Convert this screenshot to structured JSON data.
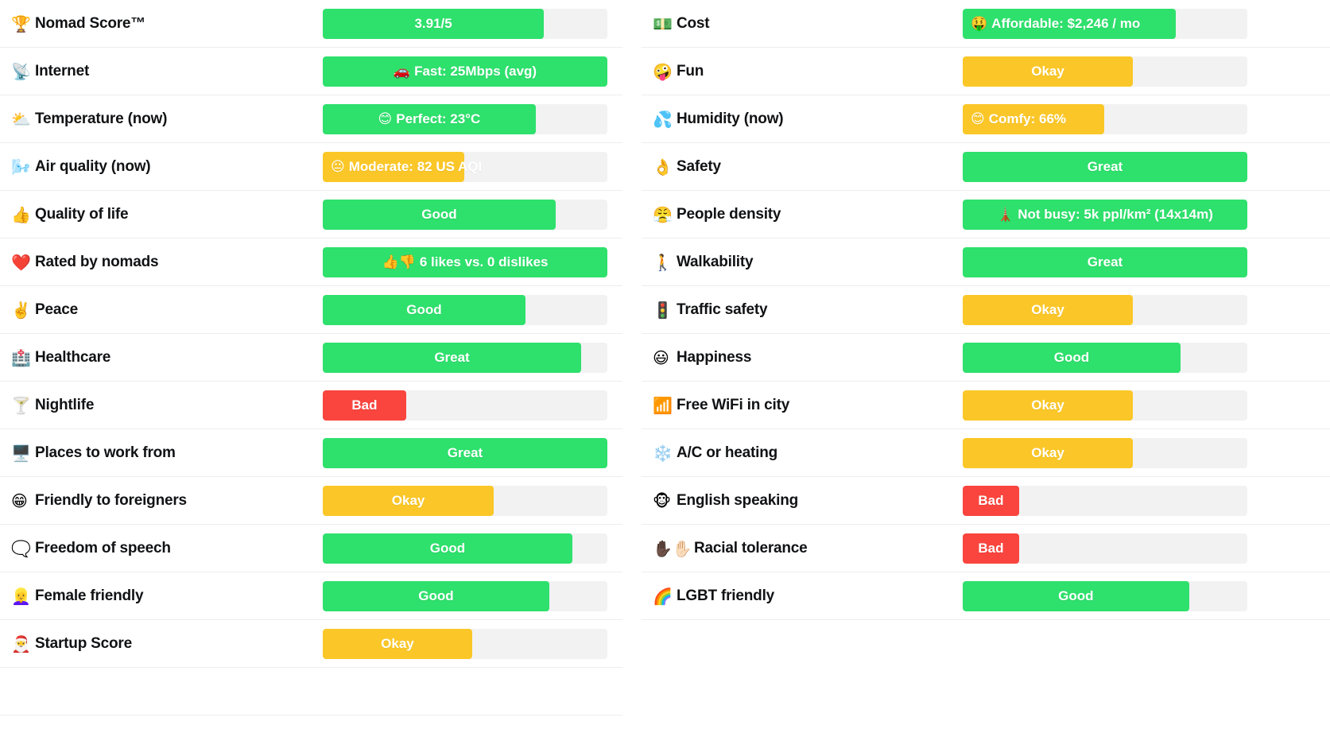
{
  "palette": {
    "good": "#2ee06c",
    "okay": "#fbc728",
    "bad": "#f9453e",
    "track": "#f2f2f3",
    "text_dark": "#111214",
    "text_light": "#ffffff",
    "row_border": "#ededee",
    "page_bg": "#ffffff"
  },
  "legend": {
    "good_label": "Good",
    "great_label": "Great",
    "okay_label": "Okay",
    "bad_label": "Bad"
  },
  "chart_data": {
    "type": "bar",
    "title": "",
    "xlabel": "",
    "ylabel": "",
    "orientation": "horizontal",
    "scale_note": "Bar fill fraction of full track width (0.0-1.0)",
    "columns": [
      "left",
      "right"
    ],
    "categories": [
      "Nomad Score™",
      "Internet",
      "Temperature (now)",
      "Air quality (now)",
      "Quality of life",
      "Rated by nomads",
      "Peace",
      "Healthcare",
      "Nightlife",
      "Places to work from",
      "Friendly to foreigners",
      "Freedom of speech",
      "Female friendly",
      "Startup Score",
      "Cost",
      "Fun",
      "Humidity (now)",
      "Safety",
      "People density",
      "Walkability",
      "Traffic safety",
      "Happiness",
      "Free WiFi in city",
      "A/C or heating",
      "English speaking",
      "Racial tolerance",
      "LGBT friendly"
    ],
    "values": [
      0.78,
      1.0,
      0.75,
      0.5,
      0.82,
      1.0,
      0.71,
      0.91,
      0.29,
      1.0,
      0.6,
      0.88,
      0.79,
      0.53,
      0.75,
      0.6,
      0.5,
      1.0,
      1.0,
      1.0,
      0.6,
      0.77,
      0.6,
      0.6,
      0.2,
      0.2,
      0.8
    ],
    "ratings": [
      "good",
      "good",
      "good",
      "okay",
      "good",
      "good",
      "good",
      "good",
      "bad",
      "good",
      "okay",
      "good",
      "good",
      "okay",
      "good",
      "okay",
      "okay",
      "good",
      "good",
      "good",
      "okay",
      "good",
      "okay",
      "okay",
      "bad",
      "bad",
      "good"
    ]
  },
  "left_column": {
    "rows": [
      {
        "icon": "🏆",
        "icon_name": "trophy-icon",
        "label": "Nomad Score™",
        "bar": {
          "rating": "good",
          "fill": 0.777,
          "text": "3.91/5",
          "text_mode": "centered",
          "emoji": ""
        }
      },
      {
        "icon": "📡",
        "icon_name": "satellite-antenna-icon",
        "label": "Internet",
        "bar": {
          "rating": "good",
          "fill": 1.0,
          "text": "Fast: 25Mbps (avg)",
          "text_mode": "centered",
          "emoji": "🚗"
        }
      },
      {
        "icon": "⛅",
        "icon_name": "sun-behind-cloud-icon",
        "label": "Temperature (now)",
        "bar": {
          "rating": "good",
          "fill": 0.748,
          "text": "Perfect: 23°C",
          "text_mode": "centered",
          "emoji": "😊"
        }
      },
      {
        "icon": "🌬️",
        "icon_name": "wind-face-icon",
        "label": "Air quality (now)",
        "bar": {
          "rating": "okay",
          "fill": 0.497,
          "text": "Moderate: 82 US AQI",
          "text_mode": "overflow",
          "emoji": "😐"
        }
      },
      {
        "icon": "👍",
        "icon_name": "thumbs-up-icon",
        "label": "Quality of life",
        "bar": {
          "rating": "good",
          "fill": 0.818,
          "text": "Good",
          "text_mode": "centered",
          "emoji": ""
        }
      },
      {
        "icon": "❤️",
        "icon_name": "red-heart-icon",
        "label": "Rated by nomads",
        "bar": {
          "rating": "good",
          "fill": 1.0,
          "text": "6 likes vs. 0 dislikes",
          "text_mode": "centered",
          "emoji": "👍👎"
        }
      },
      {
        "icon": "✌️",
        "icon_name": "victory-hand-icon",
        "label": "Peace",
        "bar": {
          "rating": "good",
          "fill": 0.712,
          "text": "Good",
          "text_mode": "centered",
          "emoji": ""
        }
      },
      {
        "icon": "🏥",
        "icon_name": "hospital-icon",
        "label": "Healthcare",
        "bar": {
          "rating": "good",
          "fill": 0.908,
          "text": "Great",
          "text_mode": "centered",
          "emoji": ""
        }
      },
      {
        "icon": "🍸",
        "icon_name": "cocktail-glass-icon",
        "label": "Nightlife",
        "bar": {
          "rating": "bad",
          "fill": 0.293,
          "text": "Bad",
          "text_mode": "centered",
          "emoji": ""
        }
      },
      {
        "icon": "🖥️",
        "icon_name": "desktop-computer-icon",
        "label": "Places to work from",
        "bar": {
          "rating": "good",
          "fill": 1.0,
          "text": "Great",
          "text_mode": "centered",
          "emoji": ""
        }
      },
      {
        "icon": "😁",
        "icon_name": "grinning-face-icon",
        "label": "Friendly to foreigners",
        "bar": {
          "rating": "okay",
          "fill": 0.601,
          "text": "Okay",
          "text_mode": "centered",
          "emoji": ""
        }
      },
      {
        "icon": "🗨️",
        "icon_name": "speech-bubble-icon",
        "label": "Freedom of speech",
        "bar": {
          "rating": "good",
          "fill": 0.877,
          "text": "Good",
          "text_mode": "centered",
          "emoji": ""
        }
      },
      {
        "icon": "👱‍♀️",
        "icon_name": "woman-blond-hair-icon",
        "label": "Female friendly",
        "bar": {
          "rating": "good",
          "fill": 0.796,
          "text": "Good",
          "text_mode": "centered",
          "emoji": ""
        }
      },
      {
        "icon": "🎅",
        "icon_name": "santa-claus-icon",
        "label": "Startup Score",
        "bar": {
          "rating": "okay",
          "fill": 0.525,
          "text": "Okay",
          "text_mode": "centered",
          "emoji": ""
        }
      }
    ]
  },
  "right_column": {
    "rows": [
      {
        "icon": "💵",
        "icon_name": "banknote-icon",
        "label": "Cost",
        "bar": {
          "rating": "good",
          "fill": 0.749,
          "text": "Affordable: $2,246 / mo",
          "text_mode": "overflow",
          "emoji": "🤑"
        }
      },
      {
        "icon": "🤪",
        "icon_name": "zany-face-icon",
        "label": "Fun",
        "bar": {
          "rating": "okay",
          "fill": 0.598,
          "text": "Okay",
          "text_mode": "centered",
          "emoji": ""
        }
      },
      {
        "icon": "💦",
        "icon_name": "sweat-droplets-icon",
        "label": "Humidity (now)",
        "bar": {
          "rating": "okay",
          "fill": 0.497,
          "text": "Comfy: 66%",
          "text_mode": "overflow",
          "emoji": "😊"
        }
      },
      {
        "icon": "👌",
        "icon_name": "ok-hand-icon",
        "label": "Safety",
        "bar": {
          "rating": "good",
          "fill": 1.0,
          "text": "Great",
          "text_mode": "centered",
          "emoji": ""
        }
      },
      {
        "icon": "😤",
        "icon_name": "face-with-steam-icon",
        "label": "People density",
        "bar": {
          "rating": "good",
          "fill": 1.0,
          "text": "Not busy: 5k ppl/km² (14x14m)",
          "text_mode": "centered",
          "emoji": "🗼"
        }
      },
      {
        "icon": "🚶",
        "icon_name": "person-walking-icon",
        "label": "Walkability",
        "bar": {
          "rating": "good",
          "fill": 1.0,
          "text": "Great",
          "text_mode": "centered",
          "emoji": ""
        }
      },
      {
        "icon": "🚦",
        "icon_name": "traffic-light-icon",
        "label": "Traffic safety",
        "bar": {
          "rating": "okay",
          "fill": 0.598,
          "text": "Okay",
          "text_mode": "centered",
          "emoji": ""
        }
      },
      {
        "icon": "😃",
        "icon_name": "smiling-face-open-mouth-icon",
        "label": "Happiness",
        "bar": {
          "rating": "good",
          "fill": 0.765,
          "text": "Good",
          "text_mode": "centered",
          "emoji": ""
        }
      },
      {
        "icon": "📶",
        "icon_name": "antenna-bars-icon",
        "label": "Free WiFi in city",
        "bar": {
          "rating": "okay",
          "fill": 0.598,
          "text": "Okay",
          "text_mode": "centered",
          "emoji": ""
        }
      },
      {
        "icon": "❄️",
        "icon_name": "snowflake-icon",
        "label": "A/C or heating",
        "bar": {
          "rating": "okay",
          "fill": 0.598,
          "text": "Okay",
          "text_mode": "centered",
          "emoji": ""
        }
      },
      {
        "icon": "🐵",
        "icon_name": "monkey-face-icon",
        "label": "English speaking",
        "bar": {
          "rating": "bad",
          "fill": 0.198,
          "text": "Bad",
          "text_mode": "centered",
          "emoji": ""
        }
      },
      {
        "icon": "✋🏿✋🏻",
        "icon_name": "raised-hands-skin-tones-icon",
        "icon_wide": true,
        "label": "Racial tolerance",
        "bar": {
          "rating": "bad",
          "fill": 0.198,
          "text": "Bad",
          "text_mode": "centered",
          "emoji": ""
        }
      },
      {
        "icon": "🌈",
        "icon_name": "rainbow-icon",
        "label": "LGBT friendly",
        "bar": {
          "rating": "good",
          "fill": 0.795,
          "text": "Good",
          "text_mode": "centered",
          "emoji": ""
        }
      }
    ]
  }
}
